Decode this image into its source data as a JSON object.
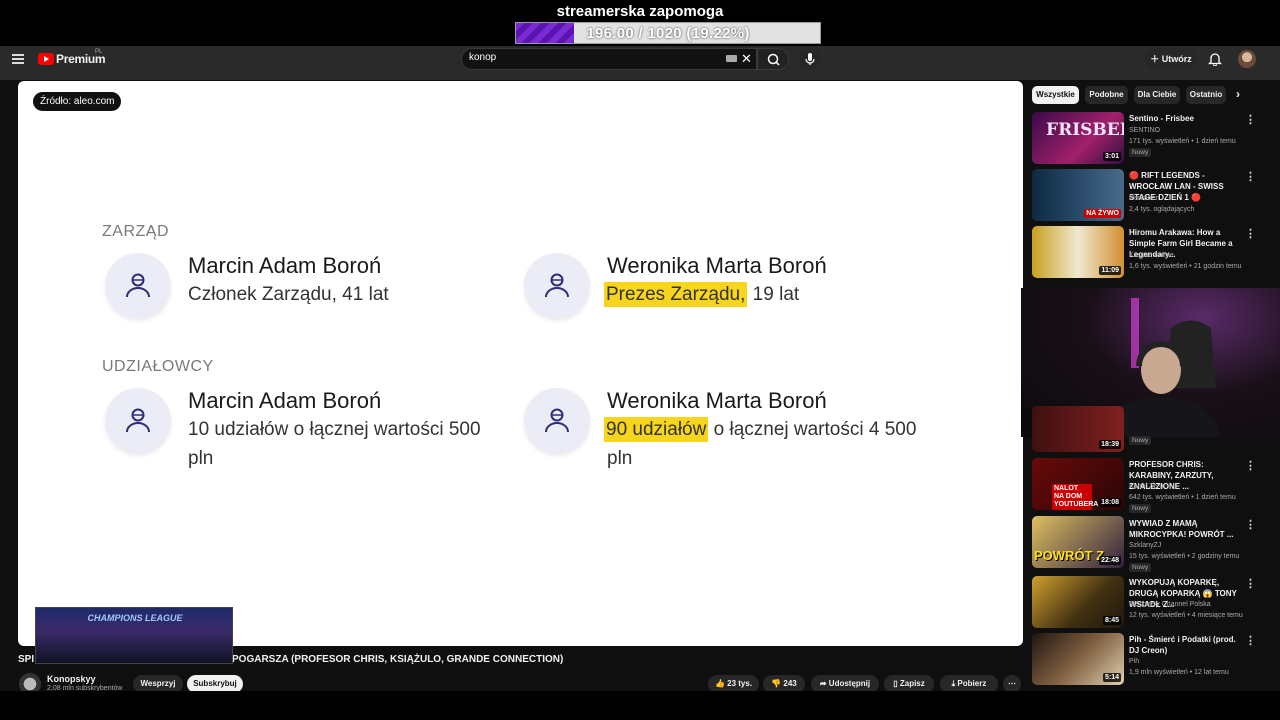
{
  "overlay": {
    "title": "streamerska zapomoga",
    "goal_text": "196.00 / 1020 (19.22%)",
    "goal_fraction": 0.1922
  },
  "header": {
    "logo_text": "Premium",
    "logo_region": "PL",
    "search_value": "konop",
    "create_label": "Utwórz"
  },
  "panel": {
    "source": "Źródło: aleo.com",
    "zarzad_heading": "ZARZĄD",
    "udzialowcy_heading": "UDZIAŁOWCY",
    "zarzad": [
      {
        "name": "Marcin Adam Boroń",
        "desc": "Członek Zarządu, 41 lat",
        "highlight": "",
        "rest": ""
      },
      {
        "name": "Weronika Marta Boroń",
        "desc": "",
        "highlight": "Prezes Zarządu,",
        "rest": " 19 lat"
      }
    ],
    "udzialowcy": [
      {
        "name": "Marcin Adam Boroń",
        "line1": "10 udziałów o łącznej wartości 500",
        "line2": "pln"
      },
      {
        "name": "Weronika Marta Boroń",
        "highlight": "90 udziałów",
        "line1rest": " o łącznej wartości 4 500",
        "line2": "pln"
      }
    ]
  },
  "chips": [
    "Wszystkie",
    "Podobne",
    "Dla Ciebie",
    "Ostatnio"
  ],
  "videos": [
    {
      "title": "Sentino - Frisbee",
      "channel": "SENTINO",
      "meta": "171 tys. wyświetleń • 1 dzień temu",
      "badge": "Nowy",
      "duration": "3:01",
      "thumb": "FRISBEE"
    },
    {
      "title": "🔴 RIFT LEGENDS - WROCŁAW LAN - SWISS STAGE DZIEŃ 1 🔴",
      "channel": "Nervarien",
      "meta": "2,4 tys. oglądających",
      "badge": "",
      "duration": "NA ŻYWO"
    },
    {
      "title": "Hiromu Arakawa: How a Simple Farm Girl Became a Legendary...",
      "channel": "Kitsune Anime",
      "meta": "1,6 tys. wyświetleń • 21 godzin temu",
      "badge": "",
      "duration": "11:09"
    },
    {
      "title": "",
      "channel": "",
      "meta": "",
      "badge": "Nowy",
      "duration": "18:39"
    },
    {
      "title": "PROFESOR CHRIS: KARABINY, ZARZUTY, ZNALEZIONE ...",
      "channel": "Kanał Zero",
      "meta": "642 tys. wyświetleń • 1 dzień temu",
      "badge": "Nowy",
      "duration": "18:08",
      "thumb": "NALOT NA DOM YOUTUBERA"
    },
    {
      "title": "WYWIAD Z MAMĄ MIKROCYPKA! POWRÓT ...",
      "channel": "SzklanyZJ",
      "meta": "15 tys. wyświetleń • 2 godziny temu",
      "badge": "Nowy",
      "duration": "22:48",
      "thumb": "POWRÓT Z"
    },
    {
      "title": "WYKOPUJĄ KOPARKĘ, DRUGĄ KOPARKĄ 😱 TONY WSIADŁ Z...",
      "channel": "Discovery Channel Polska",
      "meta": "12 tys. wyświetleń • 4 miesiące temu",
      "badge": "",
      "duration": "8:45"
    },
    {
      "title": "Pih - Śmierć i Podatki (prod. DJ Creon)",
      "channel": "Pih",
      "meta": "1,9 mln wyświetleń • 12 lat temu",
      "badge": "",
      "duration": "5:14"
    }
  ],
  "bottom": {
    "title_left": "SPI",
    "title_right": "POGARSZA (PROFESOR CHRIS, KSIĄŻULO, GRANDE CONNECTION)",
    "cl_thumb_text": "CHAMPIONS LEAGUE",
    "channel": "Konopskyy",
    "subs": "2,08 mln subskrybentów",
    "support": "Wesprzyj",
    "subscribe": "Subskrybuj",
    "likes": "23 tys.",
    "dislikes": "243",
    "share": "Udostępnij",
    "save": "Zapisz",
    "download": "Pobierz"
  },
  "colors": {
    "highlight": "#f7d51d",
    "yt_red": "#ff0000",
    "goal_purple": "#7b2bd6"
  }
}
